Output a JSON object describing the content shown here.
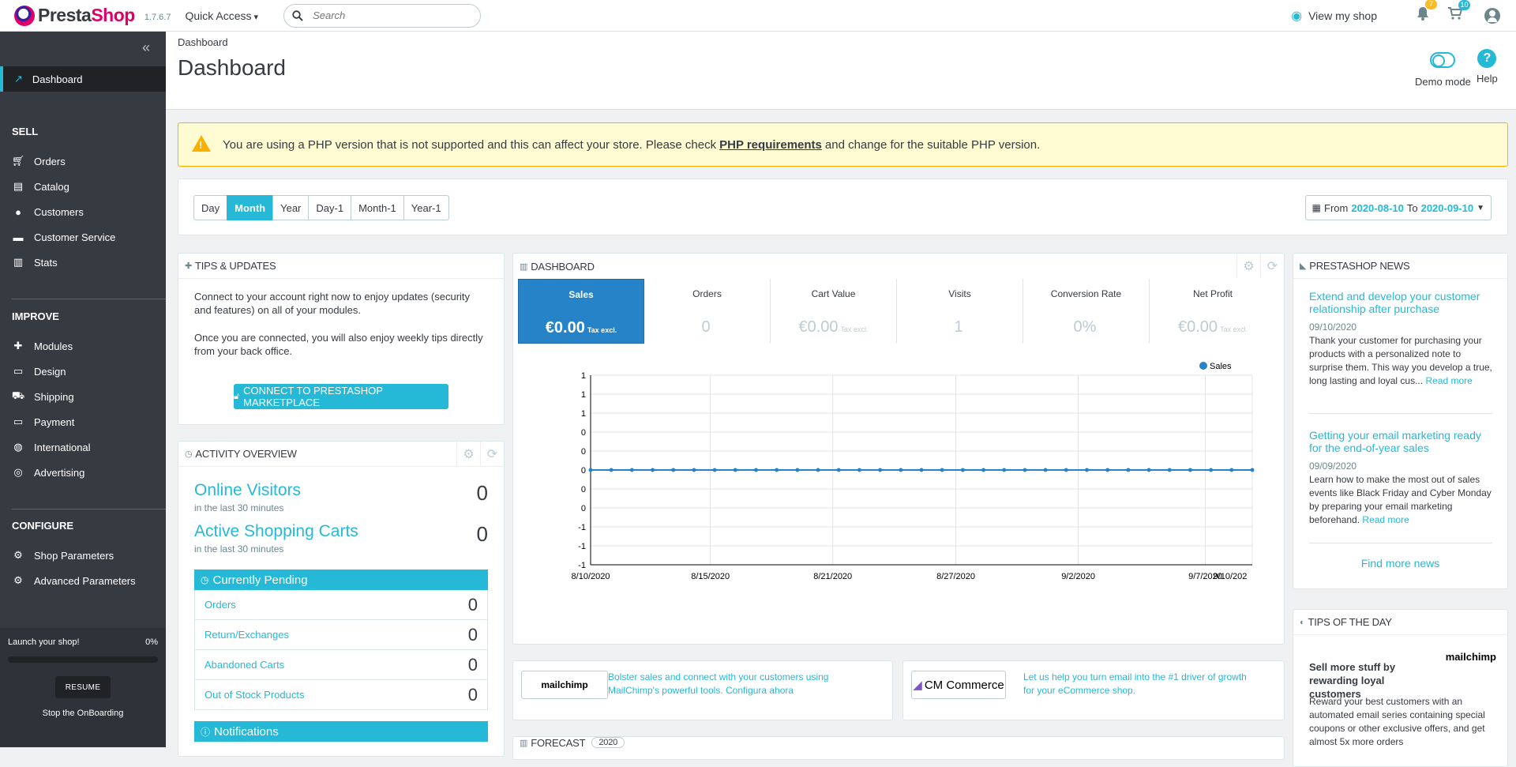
{
  "header": {
    "brand_a": "Presta",
    "brand_b": "Shop",
    "version": "1.7.6.7",
    "quick_access": "Quick Access",
    "search_placeholder": "Search",
    "view_shop": "View my shop",
    "notif_orders": "7",
    "notif_customers": "10"
  },
  "sidebar": {
    "dashboard": "Dashboard",
    "sell": "SELL",
    "sell_items": [
      "Orders",
      "Catalog",
      "Customers",
      "Customer Service",
      "Stats"
    ],
    "improve": "IMPROVE",
    "improve_items": [
      "Modules",
      "Design",
      "Shipping",
      "Payment",
      "International",
      "Advertising"
    ],
    "configure": "CONFIGURE",
    "configure_items": [
      "Shop Parameters",
      "Advanced Parameters"
    ],
    "launch_label": "Launch your shop!",
    "launch_pct": "0%",
    "launch_progress": 0,
    "resume": "RESUME",
    "stop_onboarding": "Stop the OnBoarding"
  },
  "page": {
    "breadcrumb": "Dashboard",
    "title": "Dashboard",
    "demo_mode": "Demo mode",
    "help": "Help"
  },
  "alert": {
    "text_before": "You are using a PHP version that is not supported and this can affect your store. Please check",
    "link": "PHP requirements",
    "text_after": "and change for the suitable PHP version."
  },
  "filter": {
    "periods": [
      "Day",
      "Month",
      "Year",
      "Day-1",
      "Month-1",
      "Year-1"
    ],
    "active_period": "Month",
    "from_label": "From",
    "from_date": "2020-08-10",
    "to_label": "To",
    "to_date": "2020-09-10"
  },
  "tips": {
    "title": "TIPS & UPDATES",
    "p1": "Connect to your account right now to enjoy updates (security and features) on all of your modules.",
    "p2": "Once you are connected, you will also enjoy weekly tips directly from your back office.",
    "button": "CONNECT TO PRESTASHOP MARKETPLACE"
  },
  "activity": {
    "title": "ACTIVITY OVERVIEW",
    "online_visitors": "Online Visitors",
    "online_visitors_sub": "in the last 30 minutes",
    "online_visitors_val": "0",
    "active_carts": "Active Shopping Carts",
    "active_carts_sub": "in the last 30 minutes",
    "active_carts_val": "0",
    "pending_title": "Currently Pending",
    "pending": [
      {
        "label": "Orders",
        "value": "0"
      },
      {
        "label": "Return/Exchanges",
        "value": "0"
      },
      {
        "label": "Abandoned Carts",
        "value": "0"
      },
      {
        "label": "Out of Stock Products",
        "value": "0"
      }
    ],
    "notifications": "Notifications"
  },
  "dashboard": {
    "title": "DASHBOARD",
    "kpis": [
      {
        "label": "Sales",
        "value": "€0.00",
        "suffix": "Tax excl."
      },
      {
        "label": "Orders",
        "value": "0",
        "suffix": ""
      },
      {
        "label": "Cart Value",
        "value": "€0.00",
        "suffix": "Tax excl."
      },
      {
        "label": "Visits",
        "value": "1",
        "suffix": ""
      },
      {
        "label": "Conversion Rate",
        "value": "0%",
        "suffix": ""
      },
      {
        "label": "Net Profit",
        "value": "€0.00",
        "suffix": "Tax excl."
      }
    ]
  },
  "chart_data": {
    "type": "line",
    "series": [
      {
        "name": "Sales",
        "values": [
          0,
          0,
          0,
          0,
          0,
          0,
          0,
          0,
          0,
          0,
          0,
          0,
          0,
          0,
          0,
          0,
          0,
          0,
          0,
          0,
          0,
          0,
          0,
          0,
          0,
          0,
          0,
          0,
          0,
          0,
          0,
          0,
          0
        ]
      }
    ],
    "x_tick_labels": [
      "8/10/2020",
      "8/15/2020",
      "8/21/2020",
      "8/27/2020",
      "9/2/2020",
      "9/7/2020",
      "9/10/202"
    ],
    "y_tick_labels": [
      "1",
      "1",
      "1",
      "0",
      "0",
      "0",
      "0",
      "0",
      "-1",
      "-1",
      "-1"
    ],
    "legend_position": "top-right",
    "grid": true,
    "color": "#2783c8"
  },
  "promos": {
    "mailchimp_logo": "mailchimp",
    "mailchimp_text": "Bolster sales and connect with your customers using MailChimp's powerful tools. Configura ahora",
    "cm_logo": "CM Commerce",
    "cm_text": "Let us help you turn email into the #1 driver of growth for your eCommerce shop."
  },
  "forecast": {
    "title": "FORECAST",
    "year": "2020"
  },
  "news": {
    "title": "PRESTASHOP NEWS",
    "items": [
      {
        "title": "Extend and develop your customer relationship after purchase",
        "date": "09/10/2020",
        "body": "Thank your customer for purchasing your products with a personalized note to surprise them. This way you develop a true, long lasting and loyal cus...",
        "more": "Read more"
      },
      {
        "title": "Getting your email marketing ready for the end-of-year sales",
        "date": "09/09/2020",
        "body": "Learn how to make the most out of sales events like Black Friday and Cyber Monday by preparing your email marketing beforehand.",
        "more": "Read more"
      }
    ],
    "find_more": "Find more news"
  },
  "tip_of_day": {
    "title": "TIPS OF THE DAY",
    "logo": "mailchimp",
    "heading": "Sell more stuff by rewarding loyal customers",
    "body": "Reward your best customers with an automated email series containing special coupons or other exclusive offers, and get almost 5x more orders"
  }
}
